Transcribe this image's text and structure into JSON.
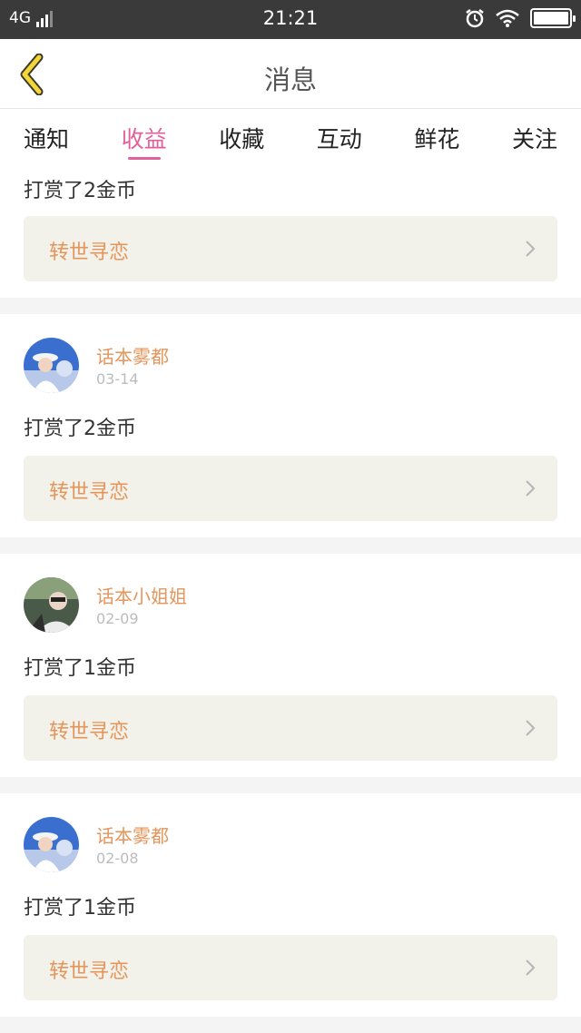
{
  "status_bar": {
    "network": "4G",
    "time": "21:21",
    "icons": [
      "signal-icon",
      "alarm-icon",
      "wifi-icon",
      "battery-icon"
    ]
  },
  "header": {
    "title": "消息",
    "back_icon": "chevron-left-icon"
  },
  "tabs": [
    {
      "label": "通知"
    },
    {
      "label": "收益",
      "active": true
    },
    {
      "label": "收藏"
    },
    {
      "label": "互动"
    },
    {
      "label": "鲜花"
    },
    {
      "label": "关注"
    }
  ],
  "colors": {
    "accent_pink": "#e0609a",
    "name_orange": "#e4955b",
    "link_bg": "#f2f2ea"
  },
  "items": [
    {
      "user": "",
      "date": "",
      "text": "打赏了2金币",
      "work": "转世寻恋"
    },
    {
      "user": "话本雾都",
      "date": "03-14",
      "text": "打赏了2金币",
      "work": "转世寻恋"
    },
    {
      "user": "话本小姐姐",
      "date": "02-09",
      "text": "打赏了1金币",
      "work": "转世寻恋"
    },
    {
      "user": "话本雾都",
      "date": "02-08",
      "text": "打赏了1金币",
      "work": "转世寻恋"
    }
  ]
}
